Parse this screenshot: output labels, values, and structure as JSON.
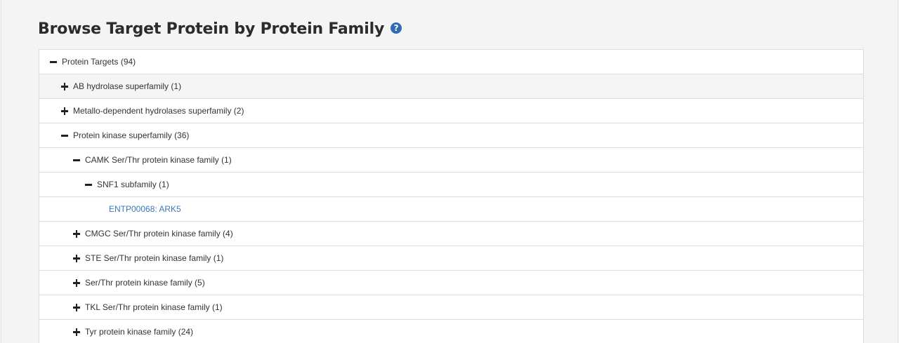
{
  "header": {
    "title": "Browse Target Protein by Protein Family",
    "help_icon": "question-circle-icon",
    "help_glyph": "?"
  },
  "tree": {
    "root": {
      "label": "Protein Targets (94)",
      "state": "expanded"
    },
    "ab_hydrolase": {
      "label": "AB hydrolase superfamily (1)",
      "state": "collapsed"
    },
    "metallo": {
      "label": "Metallo-dependent hydrolases superfamily (2)",
      "state": "collapsed"
    },
    "kinase": {
      "label": "Protein kinase superfamily (36)",
      "state": "expanded"
    },
    "camk": {
      "label": "CAMK Ser/Thr protein kinase family (1)",
      "state": "expanded"
    },
    "snf1": {
      "label": "SNF1 subfamily (1)",
      "state": "expanded"
    },
    "ark5": {
      "label": "ENTP00068: ARK5",
      "type": "link"
    },
    "cmgc": {
      "label": "CMGC Ser/Thr protein kinase family (4)",
      "state": "collapsed"
    },
    "ste": {
      "label": "STE Ser/Thr protein kinase family (1)",
      "state": "collapsed"
    },
    "serthr": {
      "label": "Ser/Thr protein kinase family (5)",
      "state": "collapsed"
    },
    "tkl": {
      "label": "TKL Ser/Thr protein kinase family (1)",
      "state": "collapsed"
    },
    "tyr": {
      "label": "Tyr protein kinase family (24)",
      "state": "collapsed"
    }
  },
  "colors": {
    "link": "#3a78b8",
    "help_icon_bg": "#2e6bb0",
    "hover_row_bg": "#f5f5f5",
    "border": "#dddddd"
  }
}
